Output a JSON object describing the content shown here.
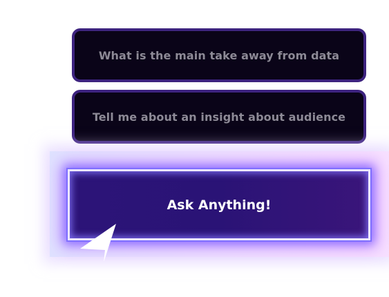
{
  "suggestions": [
    {
      "label": "What is the main take away from data"
    },
    {
      "label": "Tell me about an insight about audience"
    }
  ],
  "ask_button": {
    "label": "Ask Anything!"
  },
  "colors": {
    "suggestion_bg": "#0a0418",
    "suggestion_border": "#3d237f",
    "suggestion_text": "#8d8a96",
    "ask_bg": "#2c1478",
    "glow_blue": "#7d6eff",
    "glow_pink": "#d76eff"
  },
  "icons": {
    "pointer": "cursor-arrow-icon"
  }
}
